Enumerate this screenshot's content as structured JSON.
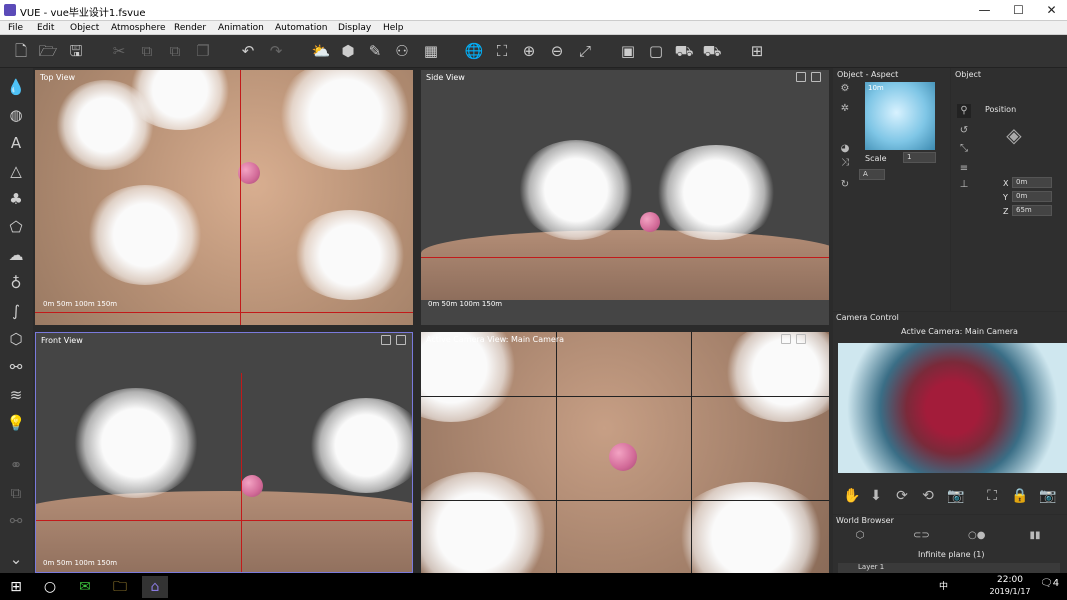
{
  "window": {
    "title": "VUE - vue毕业设计1.fsvue",
    "min": "—",
    "max": "☐",
    "close": "✕"
  },
  "menu": [
    "File",
    "Edit",
    "Object",
    "Atmosphere",
    "Render",
    "Animation",
    "Automation",
    "Display",
    "Help"
  ],
  "viewports": {
    "top": {
      "label": "Top View"
    },
    "side": {
      "label": "Side View"
    },
    "front": {
      "label": "Front View"
    },
    "camera": {
      "label": "Active Camera View: Main Camera"
    }
  },
  "scale_labels": [
    "0m",
    "50m",
    "100m",
    "150m"
  ],
  "axis_labels": {
    "x": "X",
    "y": "Y",
    "z": "Z"
  },
  "object_aspect": {
    "title": "Object - Aspect",
    "thumb_label": "10m",
    "scale_label": "Scale",
    "scale_value": "1",
    "letter": "A"
  },
  "object": {
    "title": "Object",
    "position_label": "Position",
    "x_label": "X",
    "x": "0m",
    "y_label": "Y",
    "y": "0m",
    "z_label": "Z",
    "z": "65m"
  },
  "camera_control": {
    "title": "Camera Control",
    "active": "Active Camera: Main Camera"
  },
  "world_browser": {
    "title": "World Browser",
    "item": "Infinite plane (1)",
    "layer": "Layer 1"
  },
  "taskbar": {
    "time": "22:00",
    "date": "2019/1/17",
    "ime": "中",
    "notif": "4"
  },
  "colors": {
    "accent": "#5b4bb8",
    "axis_red": "#c21a1a",
    "axis_green": "#1dc41d",
    "axis_blue": "#1f3fd8"
  }
}
